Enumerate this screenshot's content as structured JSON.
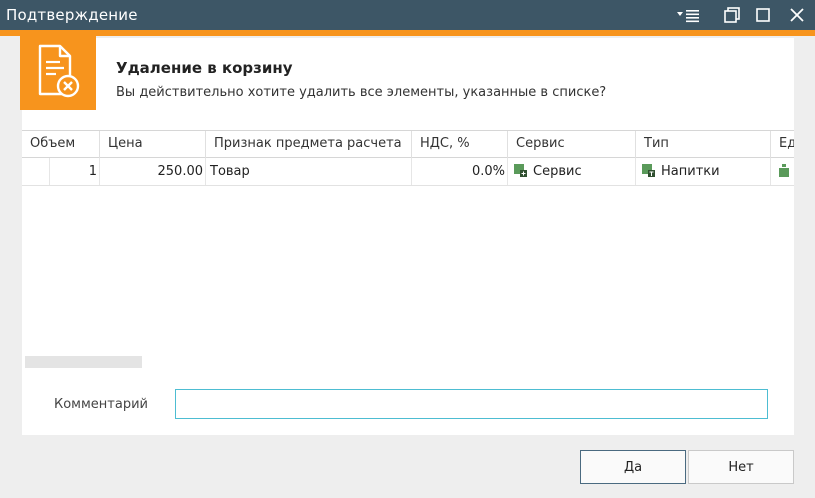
{
  "window": {
    "title": "Подтверждение"
  },
  "header": {
    "title": "Удаление в корзину",
    "message": "Вы действительно хотите удалить все элементы, указанные в списке?"
  },
  "table": {
    "columns": [
      "Объем",
      "Цена",
      "Признак предмета расчета",
      "НДС, %",
      "Сервис",
      "Тип",
      "Ед"
    ],
    "rows": [
      {
        "volume": "1",
        "price": "250.00",
        "payment_subject": "Товар",
        "vat": "0.0%",
        "service": "Сервис",
        "type": "Напитки"
      }
    ]
  },
  "comment": {
    "label": "Комментарий",
    "value": ""
  },
  "buttons": {
    "yes": "Да",
    "no": "Нет"
  },
  "colors": {
    "titlebar": "#3d5666",
    "accent": "#f7941d",
    "input_focus": "#4dbdd2",
    "green_icon": "#5a9a5a"
  },
  "icons": {
    "badge": "document-delete-icon",
    "service": "service-green-icon",
    "type": "type-green-icon",
    "unit": "unit-green-icon"
  }
}
